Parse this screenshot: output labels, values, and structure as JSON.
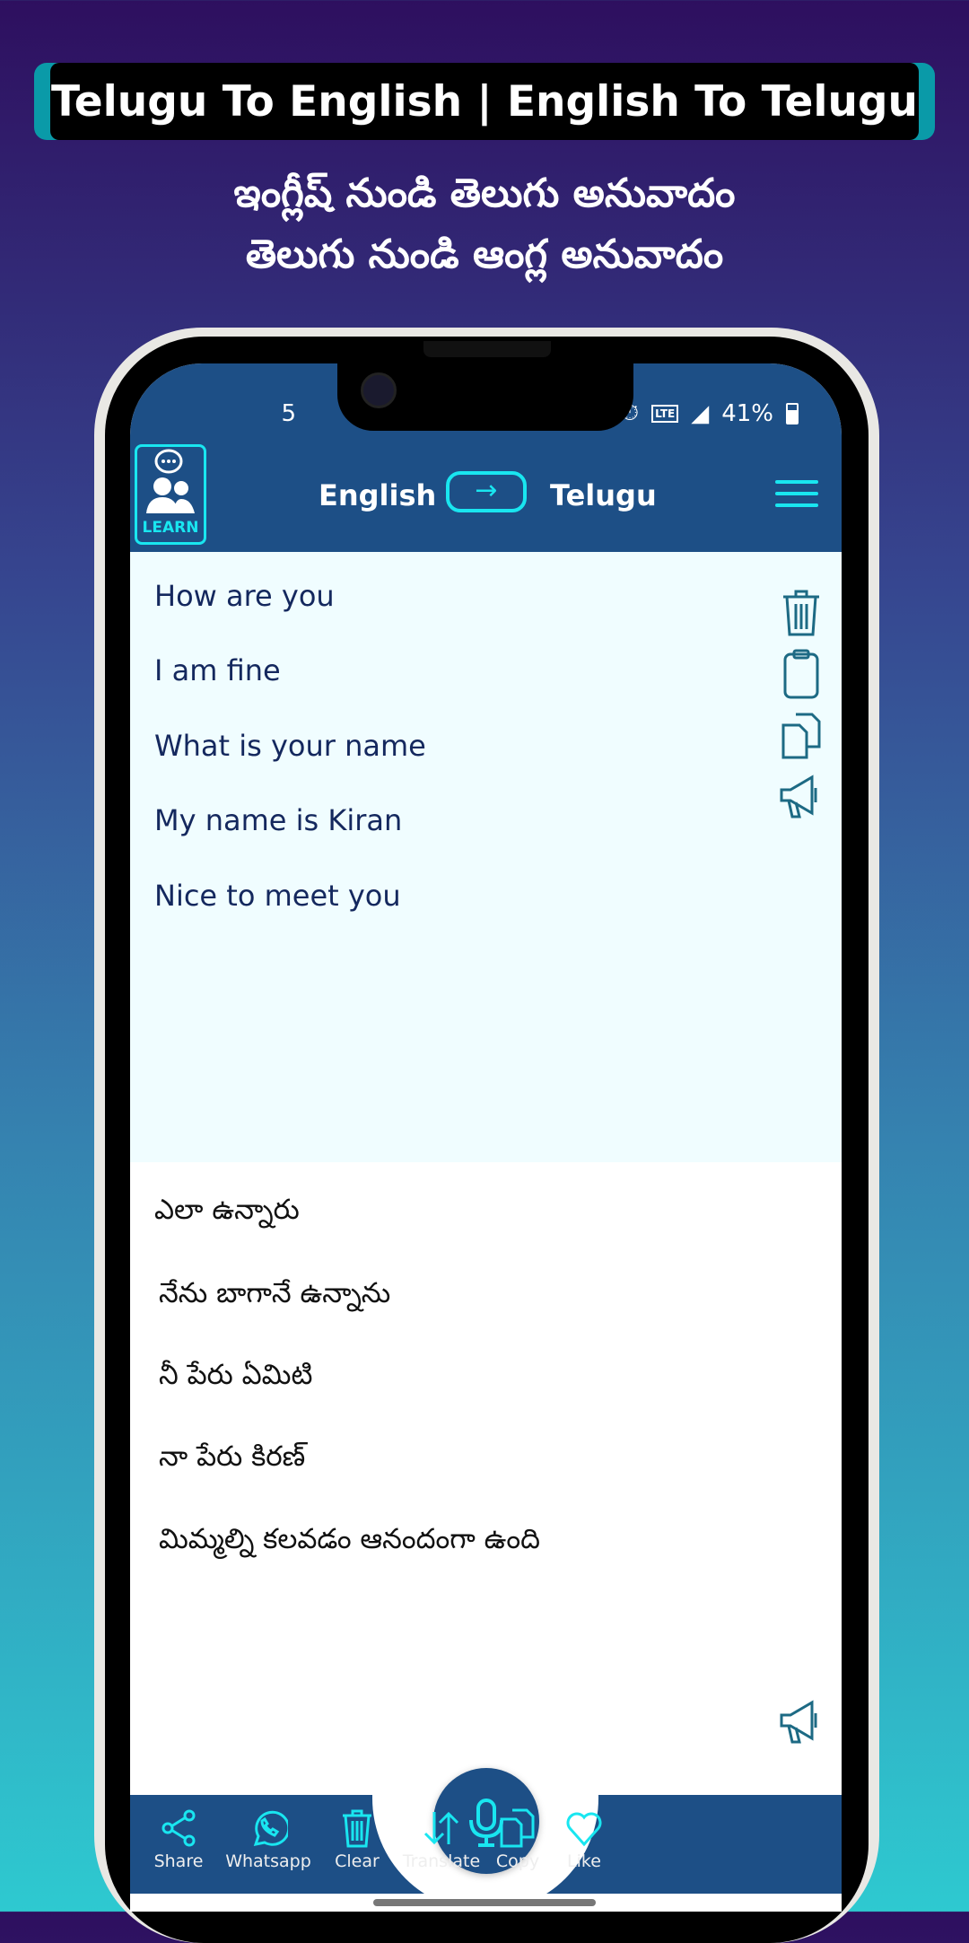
{
  "banner": {
    "title": "Telugu To English | English To Telugu",
    "subtitle_1": "ఇంగ్లీష్ నుండి తెలుగు అనువాదం",
    "subtitle_2": "తెలుగు నుండి ఆంగ్ల అనువాదం"
  },
  "status": {
    "time_partial": "5",
    "battery": "41%"
  },
  "appbar": {
    "learn_label": "LEARN",
    "source_lang": "English",
    "target_lang": "Telugu"
  },
  "input": {
    "lines": [
      "How are you",
      "I am fine",
      "What is your name",
      "My name is Kiran",
      "Nice to meet you"
    ]
  },
  "output": {
    "lines": [
      "ఎలా ఉన్నారు",
      "నేను బాగానే ఉన్నాను",
      "నీ పేరు ఏమిటి",
      "నా పేరు కిరణ్",
      "మిమ్మల్ని కలవడం ఆనందంగా ఉంది"
    ]
  },
  "nav": {
    "items": [
      {
        "label": "Share",
        "icon": "share-icon"
      },
      {
        "label": "Whatsapp",
        "icon": "whatsapp-icon"
      },
      {
        "label": "Clear",
        "icon": "trash-icon"
      },
      {
        "label": "Translate",
        "icon": "swap-vertical-icon"
      },
      {
        "label": "Copy",
        "icon": "copy-icon"
      },
      {
        "label": "Like",
        "icon": "heart-icon"
      }
    ]
  },
  "colors": {
    "primary": "#1d4f86",
    "accent": "#19e6f0",
    "input_bg": "#f0fdff",
    "icon": "#1d6a84"
  }
}
